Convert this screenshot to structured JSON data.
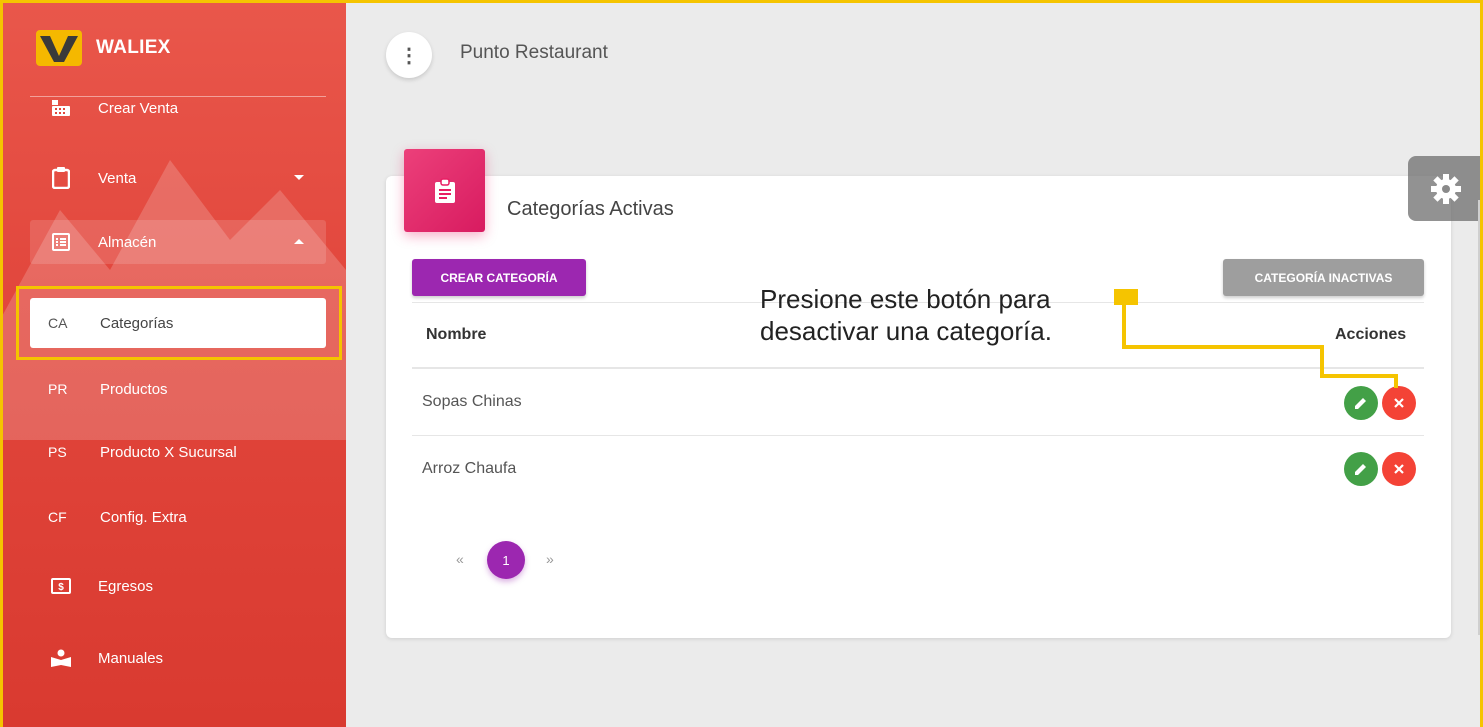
{
  "brand": {
    "name": "WALIEX"
  },
  "sidebar": {
    "items": [
      {
        "label": "Crear Venta"
      },
      {
        "label": "Venta"
      },
      {
        "label": "Almacén"
      },
      {
        "abbr": "CA",
        "label": "Categorías"
      },
      {
        "abbr": "PR",
        "label": "Productos"
      },
      {
        "abbr": "PS",
        "label": "Producto X Sucursal"
      },
      {
        "abbr": "CF",
        "label": "Config. Extra"
      },
      {
        "label": "Egresos"
      },
      {
        "label": "Manuales"
      }
    ]
  },
  "topbar": {
    "menu_icon": "⋮",
    "title": "Punto Restaurant"
  },
  "card": {
    "title": "Categorías Activas",
    "create_button": "CREAR CATEGORÍA",
    "inactive_button": "CATEGORÍA INACTIVAS",
    "columns": [
      "Nombre",
      "Acciones"
    ],
    "rows": [
      {
        "name": "Sopas Chinas"
      },
      {
        "name": "Arroz Chaufa"
      }
    ],
    "pagination": {
      "prev": "«",
      "current": "1",
      "next": "»"
    }
  },
  "annotation": {
    "line1": "Presione este botón para",
    "line2": "desactivar una categoría."
  },
  "colors": {
    "sidebar": "#e2473d",
    "accent_purple": "#9c27b0",
    "card_icon_pink": "#e91e63",
    "edit_green": "#43a047",
    "delete_red": "#f44336",
    "highlight_yellow": "#f5c400"
  }
}
